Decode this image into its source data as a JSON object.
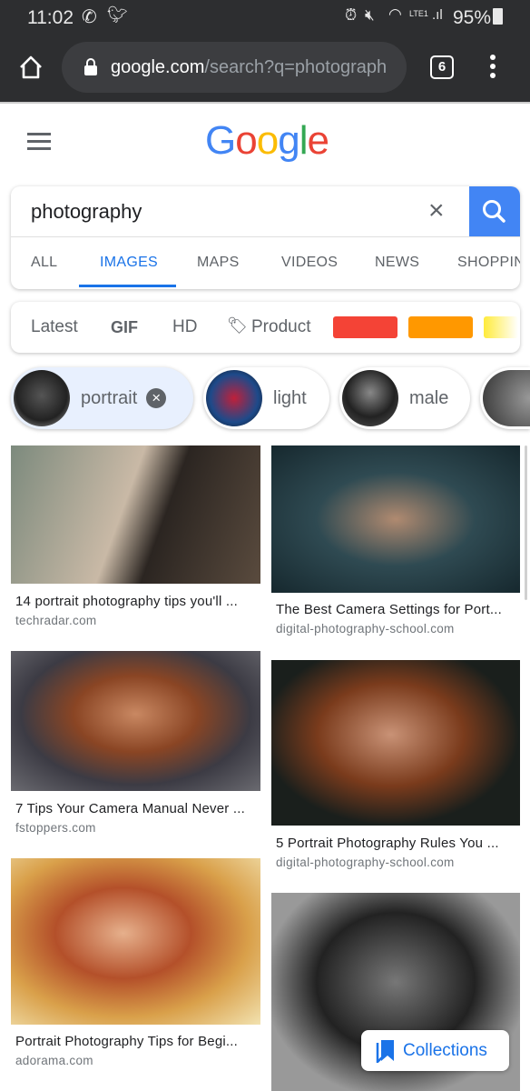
{
  "status_bar": {
    "time": "11:02",
    "battery": "95%",
    "network": "LTE1"
  },
  "browser": {
    "url_host": "google.com",
    "url_path": "/search?q=photograph",
    "tab_count": "6"
  },
  "search": {
    "query": "photography",
    "tabs": [
      "ALL",
      "IMAGES",
      "MAPS",
      "VIDEOS",
      "NEWS",
      "SHOPPING"
    ],
    "active_tab": "IMAGES"
  },
  "filters": {
    "latest": "Latest",
    "gif": "GIF",
    "hd": "HD",
    "product": "Product",
    "colors": [
      "#f44336",
      "#ff9800",
      "#ffeb3b"
    ]
  },
  "chips": [
    {
      "label": "portrait",
      "selected": true
    },
    {
      "label": "light"
    },
    {
      "label": "male"
    }
  ],
  "results": [
    {
      "title": "14 portrait photography tips you'll ...",
      "source": "techradar.com"
    },
    {
      "title": "The Best Camera Settings for Port...",
      "source": "digital-photography-school.com"
    },
    {
      "title": "7 Tips Your Camera Manual Never ...",
      "source": "fstoppers.com"
    },
    {
      "title": "5 Portrait Photography Rules You ...",
      "source": "digital-photography-school.com"
    },
    {
      "title": "Portrait Photography Tips for Begi...",
      "source": "adorama.com"
    }
  ],
  "collections_label": "Collections",
  "colors": {
    "accent": "#1a73e8",
    "search_button": "#4285f4"
  }
}
